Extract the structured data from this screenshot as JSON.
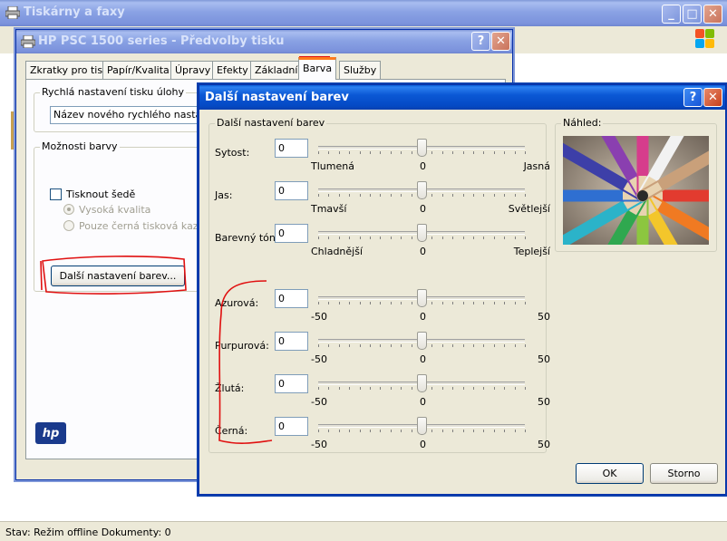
{
  "explorer": {
    "title": "Tiskárny a faxy",
    "status": "Stav: Režim offline Dokumenty: 0"
  },
  "hp_window": {
    "title": "HP PSC 1500 series - Předvolby tisku",
    "tabs": [
      {
        "label": "Zkratky pro tisk",
        "active": false
      },
      {
        "label": "Papír/Kvalita",
        "active": false
      },
      {
        "label": "Úpravy",
        "active": false
      },
      {
        "label": "Efekty",
        "active": false
      },
      {
        "label": "Základní",
        "active": false
      },
      {
        "label": "Barva",
        "active": true
      },
      {
        "label": "Služby",
        "active": false
      }
    ],
    "quick_settings": {
      "legend": "Rychlá nastavení tisku úlohy",
      "input_value": "Název nového rychlého nastavení"
    },
    "color_options": {
      "legend": "Možnosti barvy",
      "grayscale_label": "Tisknout šedě",
      "grayscale_checked": false,
      "quality_high_label": "Vysoká kvalita",
      "black_only_label": "Pouze černá tisková kazeta"
    },
    "more_color_button": "Další nastavení barev...",
    "logo_text": "hp"
  },
  "color_dialog": {
    "title": "Další nastavení barev",
    "group_legend": "Další nastavení barev",
    "preview_legend": "Náhled:",
    "sliders_basic": [
      {
        "label": "Sytost:",
        "value": "0",
        "min_label": "Tlumená",
        "mid_label": "0",
        "max_label": "Jasná",
        "position": 0.5
      },
      {
        "label": "Jas:",
        "value": "0",
        "min_label": "Tmavší",
        "mid_label": "0",
        "max_label": "Světlejší",
        "position": 0.5
      },
      {
        "label": "Barevný tón:",
        "value": "0",
        "min_label": "Chladnější",
        "mid_label": "0",
        "max_label": "Teplejší",
        "position": 0.5
      }
    ],
    "sliders_ink": [
      {
        "label": "Azurová:",
        "value": "0",
        "min_label": "-50",
        "mid_label": "0",
        "max_label": "50",
        "position": 0.5
      },
      {
        "label": "Purpurová:",
        "value": "0",
        "min_label": "-50",
        "mid_label": "0",
        "max_label": "50",
        "position": 0.5
      },
      {
        "label": "Žlutá:",
        "value": "0",
        "min_label": "-50",
        "mid_label": "0",
        "max_label": "50",
        "position": 0.5
      },
      {
        "label": "Černá:",
        "value": "0",
        "min_label": "-50",
        "mid_label": "0",
        "max_label": "50",
        "position": 0.5
      }
    ],
    "ok_label": "OK",
    "cancel_label": "Storno"
  },
  "titlebar_buttons": {
    "minimize": "_",
    "maximize": "□",
    "close": "✕",
    "help": "?"
  },
  "colors": {
    "title_blue": "#0b58d5",
    "annotation_red": "#e01010",
    "tab_highlight": "#ff7b1c"
  }
}
